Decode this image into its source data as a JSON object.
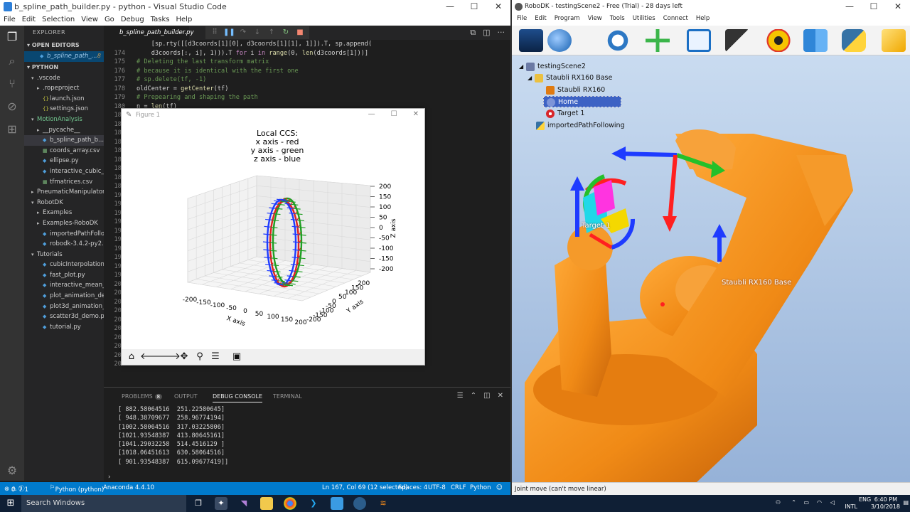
{
  "vscode": {
    "title": "b_spline_path_builder.py - python - Visual Studio Code",
    "menu": [
      "File",
      "Edit",
      "Selection",
      "View",
      "Go",
      "Debug",
      "Tasks",
      "Help"
    ],
    "explorer_header": "EXPLORER",
    "open_editors_header": "OPEN EDITORS",
    "open_editor_item": "b_spline_path_...",
    "open_editor_badge": "8",
    "python_header": "PYTHON",
    "tree": [
      {
        "label": ".vscode",
        "type": "folder-open",
        "indent": 1
      },
      {
        "label": ".ropeproject",
        "type": "folder",
        "indent": 2
      },
      {
        "label": "launch.json",
        "type": "json",
        "indent": 2
      },
      {
        "label": "settings.json",
        "type": "json",
        "indent": 2
      },
      {
        "label": "MotionAnalysis",
        "type": "folder-open",
        "indent": 1,
        "color": "#73c991"
      },
      {
        "label": "__pycache__",
        "type": "folder",
        "indent": 2
      },
      {
        "label": "b_spline_path_b...",
        "type": "py",
        "indent": 2,
        "badge": "8",
        "selected": true
      },
      {
        "label": "coords_array.csv",
        "type": "csv",
        "indent": 2
      },
      {
        "label": "ellipse.py",
        "type": "py",
        "indent": 2
      },
      {
        "label": "interactive_cubic_int...",
        "type": "py",
        "indent": 2
      },
      {
        "label": "tfmatrices.csv",
        "type": "csv",
        "indent": 2
      },
      {
        "label": "PneumaticManipulator",
        "type": "folder",
        "indent": 1
      },
      {
        "label": "RobotDK",
        "type": "folder-open",
        "indent": 1
      },
      {
        "label": "Examples",
        "type": "folder",
        "indent": 2
      },
      {
        "label": "Examples-RoboDK",
        "type": "folder",
        "indent": 2
      },
      {
        "label": "importedPathFollow...",
        "type": "py",
        "indent": 2
      },
      {
        "label": "robodk-3.4.2-py2.py...",
        "type": "py",
        "indent": 2
      },
      {
        "label": "Tutorials",
        "type": "folder-open",
        "indent": 1
      },
      {
        "label": "cubicInterpolation.py",
        "type": "py",
        "indent": 2
      },
      {
        "label": "fast_plot.py",
        "type": "py",
        "indent": 2
      },
      {
        "label": "interactive_mean_st...",
        "type": "py",
        "indent": 2
      },
      {
        "label": "plot_animation_dem...",
        "type": "py",
        "indent": 2
      },
      {
        "label": "plot3d_animation_d...",
        "type": "py",
        "indent": 2
      },
      {
        "label": "scatter3d_demo.py",
        "type": "py",
        "indent": 2
      },
      {
        "label": "tutorial.py",
        "type": "py",
        "indent": 2
      }
    ],
    "active_tab": "b_spline_path_builder.py",
    "code_lines": [
      {
        "n": "",
        "html": "    [sp.rty([[d3coords[1][0], d3coords[1][1], 1]]).T, sp.append("
      },
      {
        "n": "174",
        "html": "    d3coords[:, i], 1))).T <span class='kw'>for</span> i <span class='kw'>in</span> <span class='fn'>range</span>(0, <span class='fn'>len</span>(d3coords[1]))]"
      },
      {
        "n": "175",
        "html": "<span class='cm'># Deleting the last transform matrix</span>"
      },
      {
        "n": "176",
        "html": "<span class='cm'># because it is identical with the first one</span>"
      },
      {
        "n": "177",
        "html": "<span class='cm'># sp.delete(tf, -1)</span>"
      },
      {
        "n": "178",
        "html": "oldCenter = <span class='fn'>getCenter</span>(tf)"
      },
      {
        "n": "179",
        "html": "<span class='cm'># Prepearing and shaping the path</span>"
      },
      {
        "n": "180",
        "html": "n = <span class='fn'>len</span>(tf)"
      },
      {
        "n": "181",
        "html": ""
      },
      {
        "n": "182",
        "html": ""
      },
      {
        "n": "183",
        "html": ""
      },
      {
        "n": "184",
        "html": ""
      },
      {
        "n": "185",
        "html": ""
      },
      {
        "n": "186",
        "html": ""
      },
      {
        "n": "187",
        "html": ""
      },
      {
        "n": "188",
        "html": ""
      },
      {
        "n": "189",
        "html": ""
      },
      {
        "n": "190",
        "html": ""
      },
      {
        "n": "191",
        "html": ""
      },
      {
        "n": "192",
        "html": ""
      },
      {
        "n": "193",
        "html": ""
      },
      {
        "n": "194",
        "html": ""
      },
      {
        "n": "195",
        "html": ""
      },
      {
        "n": "196",
        "html": ""
      },
      {
        "n": "197",
        "html": ""
      },
      {
        "n": "198",
        "html": ""
      },
      {
        "n": "199",
        "html": ""
      },
      {
        "n": "200",
        "html": ""
      },
      {
        "n": "201",
        "html": ""
      },
      {
        "n": "202",
        "html": ""
      },
      {
        "n": "203",
        "html": ""
      },
      {
        "n": "204",
        "html": ""
      },
      {
        "n": "205",
        "html": ""
      },
      {
        "n": "206",
        "html": ""
      },
      {
        "n": "207",
        "html": ""
      },
      {
        "n": "208",
        "html": ""
      },
      {
        "n": "209",
        "html": ""
      }
    ],
    "panel": {
      "tabs": [
        "PROBLEMS",
        "OUTPUT",
        "DEBUG CONSOLE",
        "TERMINAL"
      ],
      "problems_count": "8",
      "active_tab": "DEBUG CONSOLE",
      "console_lines": [
        "[ 882.58064516  251.22580645]",
        "[ 948.38709677  258.96774194]",
        "[1002.58064516  317.03225806]",
        "[1021.93548387  413.80645161]",
        "[1041.29032258  514.4516129 ]",
        "[1018.06451613  630.58064516]",
        "[ 901.93548387  615.09677419]]"
      ]
    },
    "status": {
      "errors": "0",
      "warnings": "7",
      "info": "1",
      "interpreter": "Python (python)",
      "env": "Anaconda 4.4.10",
      "position": "Ln 167, Col 69 (12 selected)",
      "spaces": "Spaces: 4",
      "encoding": "UTF-8",
      "eol": "CRLF",
      "language": "Python"
    }
  },
  "figure": {
    "window_title": "Figure 1",
    "title_lines": [
      "Local CCS:",
      "x axis - red",
      "y axis - green",
      "z axis - blue"
    ],
    "xlabel": "X axis",
    "ylabel": "Y axis",
    "zlabel": "Z axis",
    "x_ticks": [
      "-200",
      "-150",
      "-100",
      "-50",
      "0",
      "50",
      "100",
      "150",
      "200"
    ],
    "y_ticks": [
      "200",
      "150",
      "100",
      "50",
      "0",
      "-50",
      "-100",
      "-150",
      "-200"
    ],
    "z_ticks": [
      "200",
      "150",
      "100",
      "50",
      "0",
      "-50",
      "-100",
      "-150",
      "-200"
    ]
  },
  "robodk": {
    "title": "RoboDK - testingScene2 - Free (Trial) - 28 days left",
    "menu": [
      "File",
      "Edit",
      "Program",
      "View",
      "Tools",
      "Utilities",
      "Connect",
      "Help"
    ],
    "tree": {
      "root": "testingScene2",
      "base": "Staubli RX160 Base",
      "robot": "Staubli RX160",
      "home": "Home",
      "target": "Target 1",
      "program": "importedPathFollowing"
    },
    "viewport_labels": {
      "target": "Target 1",
      "base": "Staubli RX160 Base"
    },
    "status": "Joint move (can't move linear)",
    "colors": {
      "robot": "#f08a16",
      "background_top": "#c9dbf0",
      "background_bottom": "#96b2d8"
    }
  },
  "taskbar": {
    "search_placeholder": "Search Windows",
    "lang": "ENG",
    "layout": "INTL",
    "time": "6:40 PM",
    "date": "3/10/2018"
  }
}
